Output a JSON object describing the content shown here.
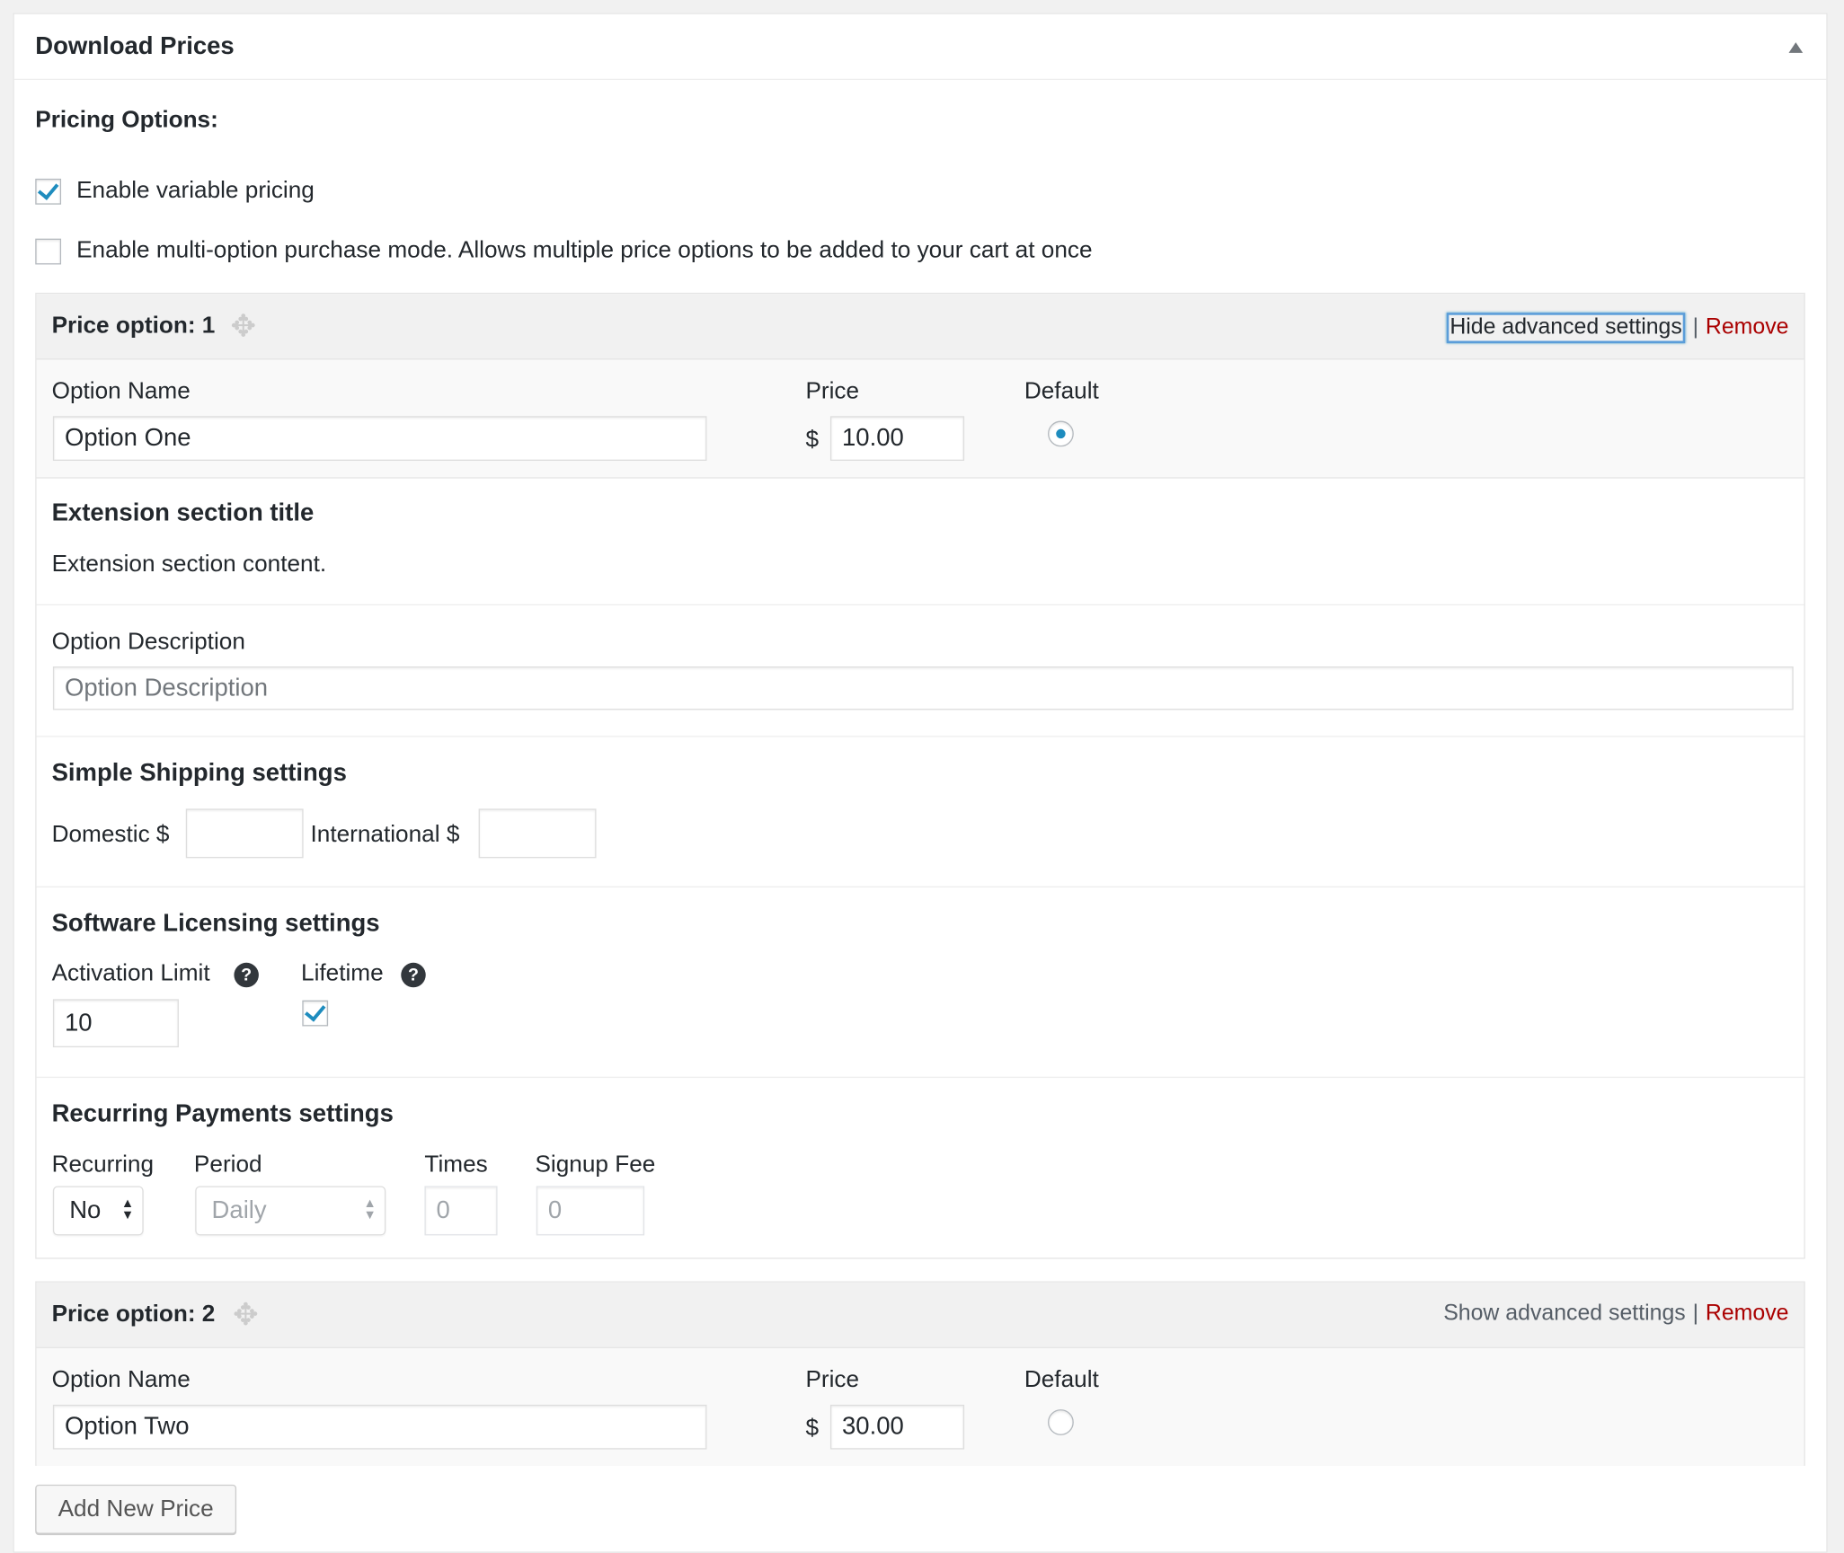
{
  "panel": {
    "title": "Download Prices"
  },
  "pricing": {
    "label": "Pricing Options:",
    "enable_variable": {
      "label": "Enable variable pricing",
      "checked": true
    },
    "multi_option": {
      "label": "Enable multi-option purchase mode. Allows multiple price options to be added to your cart at once",
      "checked": false
    }
  },
  "options": [
    {
      "title": "Price option: 1",
      "advanced_link": "Hide advanced settings",
      "separator": "|",
      "remove": "Remove",
      "name_label": "Option Name",
      "name_value": "Option One",
      "price_label": "Price",
      "currency": "$",
      "price_value": "10.00",
      "default_label": "Default",
      "is_default": true
    },
    {
      "title": "Price option: 2",
      "advanced_link": "Show advanced settings",
      "separator": "|",
      "remove": "Remove",
      "name_label": "Option Name",
      "name_value": "Option Two",
      "price_label": "Price",
      "currency": "$",
      "price_value": "30.00",
      "default_label": "Default",
      "is_default": false
    }
  ],
  "advanced": {
    "extension": {
      "title": "Extension section title",
      "content": "Extension section content."
    },
    "description": {
      "label": "Option Description",
      "placeholder": "Option Description"
    },
    "shipping": {
      "title": "Simple Shipping settings",
      "domestic_label": "Domestic $",
      "domestic_value": "",
      "international_label": "International $",
      "international_value": ""
    },
    "licensing": {
      "title": "Software Licensing settings",
      "activation_label": "Activation Limit",
      "activation_value": "10",
      "lifetime_label": "Lifetime",
      "lifetime_checked": true,
      "help_glyph": "?"
    },
    "recurring": {
      "title": "Recurring Payments settings",
      "recurring_label": "Recurring",
      "recurring_value": "No",
      "period_label": "Period",
      "period_value": "Daily",
      "times_label": "Times",
      "times_value": "0",
      "fee_label": "Signup Fee",
      "fee_value": "0"
    }
  },
  "add_button": "Add New Price",
  "icons": {
    "move": "move-icon",
    "help": "help-icon",
    "collapse": "triangle-up-icon"
  },
  "colors": {
    "accent": "#1e8cbe",
    "remove": "#aa0000"
  }
}
